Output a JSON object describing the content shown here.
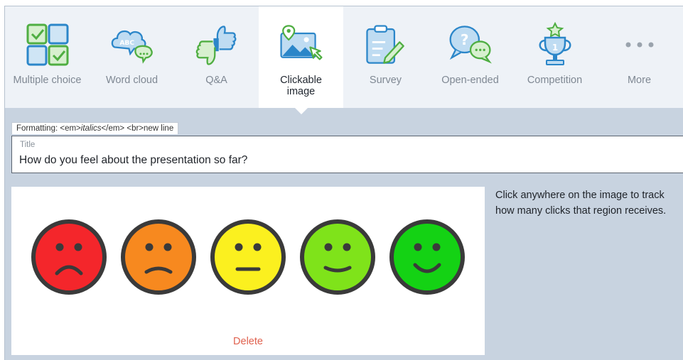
{
  "toolbar": {
    "items": [
      {
        "label": "Multiple choice",
        "icon": "multiple-choice-icon",
        "active": false
      },
      {
        "label": "Word cloud",
        "icon": "word-cloud-icon",
        "active": false
      },
      {
        "label": "Q&A",
        "icon": "qa-thumbs-icon",
        "active": false
      },
      {
        "label": "Clickable image",
        "icon": "clickable-image-icon",
        "active": true
      },
      {
        "label": "Survey",
        "icon": "survey-clipboard-icon",
        "active": false
      },
      {
        "label": "Open-ended",
        "icon": "open-ended-icon",
        "active": false
      },
      {
        "label": "Competition",
        "icon": "trophy-icon",
        "active": false
      },
      {
        "label": "More",
        "icon": "more-dots-icon",
        "active": false
      }
    ],
    "word_cloud_badge": "ABC",
    "trophy_number": "1"
  },
  "formatting": {
    "prefix": "Formatting: ",
    "em_open": "<em>",
    "em_text": "italics",
    "em_close": "</em>",
    "br": " <br>",
    "br_text": "new line"
  },
  "title_field": {
    "caption": "Title",
    "value": "How do you feel about the presentation so far?"
  },
  "image": {
    "delete_label": "Delete",
    "faces": [
      {
        "name": "very-sad",
        "color": "#f4262b"
      },
      {
        "name": "sad",
        "color": "#f7891f"
      },
      {
        "name": "neutral",
        "color": "#fbf01f"
      },
      {
        "name": "happy",
        "color": "#7fe31a"
      },
      {
        "name": "very-happy",
        "color": "#14d214"
      }
    ]
  },
  "hint_text": "Click anywhere on the image to track how many clicks that region receives.",
  "colors": {
    "accent_green": "#5ab946",
    "accent_blue": "#1f8ad1",
    "delete_red": "#e0624f",
    "face_outline": "#3a3a3a"
  }
}
